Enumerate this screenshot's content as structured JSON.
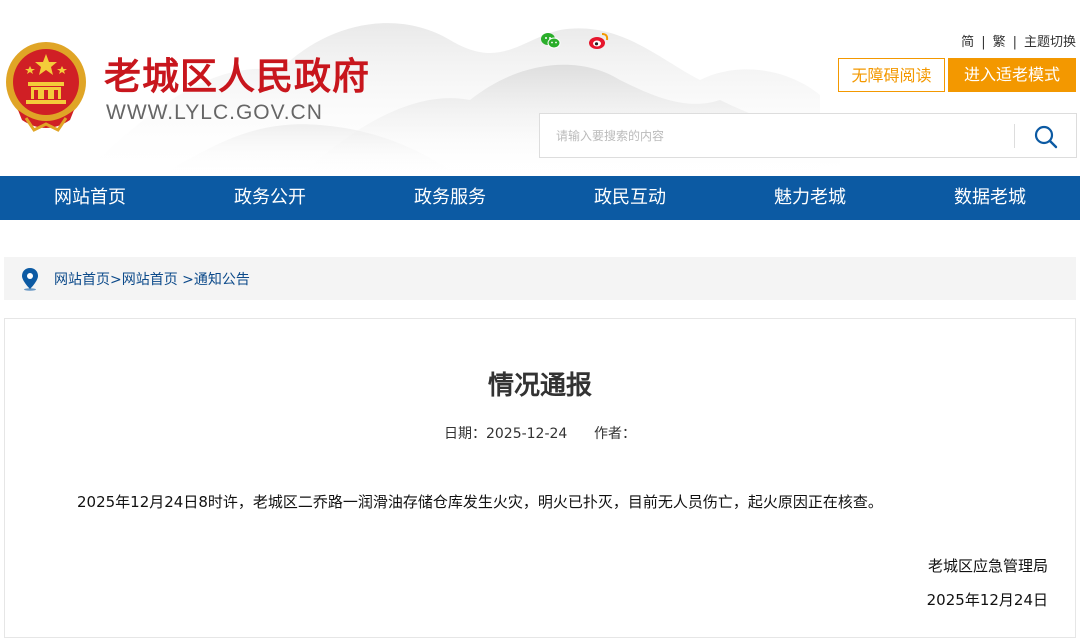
{
  "header": {
    "site_title": "老城区人民政府",
    "site_url": "WWW.LYLC.GOV.CN",
    "lang_simplified": "简",
    "lang_traditional": "繁",
    "theme_switch": "主题切换",
    "separator": "|",
    "accessible_reading": "无障碍阅读",
    "elder_mode": "进入适老模式",
    "search_placeholder": "请输入要搜索的内容",
    "social_icons": [
      "wechat-icon",
      "weibo-icon"
    ]
  },
  "nav": {
    "items": [
      {
        "label": "网站首页"
      },
      {
        "label": "政务公开"
      },
      {
        "label": "政务服务"
      },
      {
        "label": "政民互动"
      },
      {
        "label": "魅力老城"
      },
      {
        "label": "数据老城"
      }
    ]
  },
  "breadcrumb": {
    "icon": "location-pin-icon",
    "items": [
      "网站首页",
      "网站首页",
      "通知公告"
    ],
    "separators": [
      ">",
      " >"
    ]
  },
  "article": {
    "title": "情况通报",
    "meta": "日期：2025-12-24      作者：",
    "body": "2025年12月24日8时许，老城区二乔路一润滑油存储仓库发生火灾，明火已扑灭，目前无人员伤亡，起火原因正在核查。",
    "signature": "老城区应急管理局",
    "date": "2025年12月24日"
  },
  "colors": {
    "nav_blue": "#0c5aa3",
    "title_red": "#c8161d",
    "accent_orange": "#f39800",
    "breadcrumb_text": "#0c4a8a"
  }
}
